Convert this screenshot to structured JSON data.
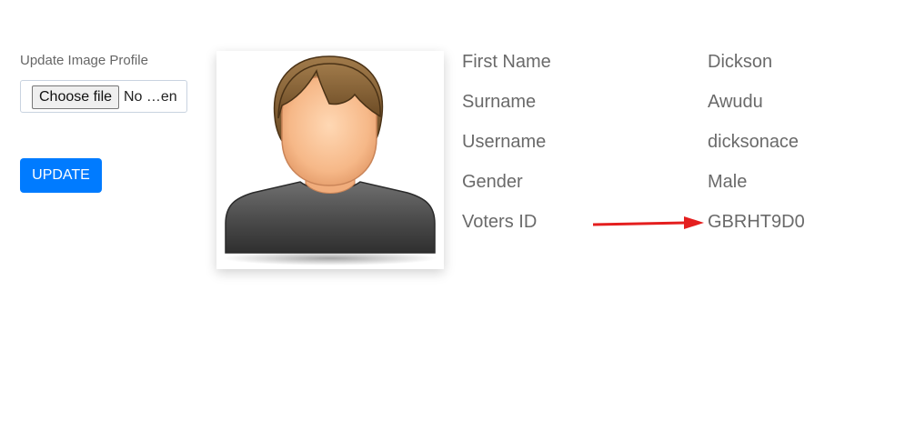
{
  "upload": {
    "label": "Update Image Profile",
    "choose_button": "Choose file",
    "file_status": "No …en",
    "update_button": "UPDATE"
  },
  "avatar": {
    "icon": "default-user-avatar-icon"
  },
  "profile": {
    "rows": [
      {
        "label": "First Name",
        "value": "Dickson"
      },
      {
        "label": "Surname",
        "value": "Awudu"
      },
      {
        "label": "Username",
        "value": "dicksonace"
      },
      {
        "label": "Gender",
        "value": "Male"
      },
      {
        "label": "Voters ID",
        "value": "GBRHT9D0"
      }
    ]
  },
  "annotation": {
    "icon": "red-arrow-icon",
    "color": "#e41e1e"
  },
  "colors": {
    "primary": "#007bff",
    "text": "#6a6a6a"
  }
}
